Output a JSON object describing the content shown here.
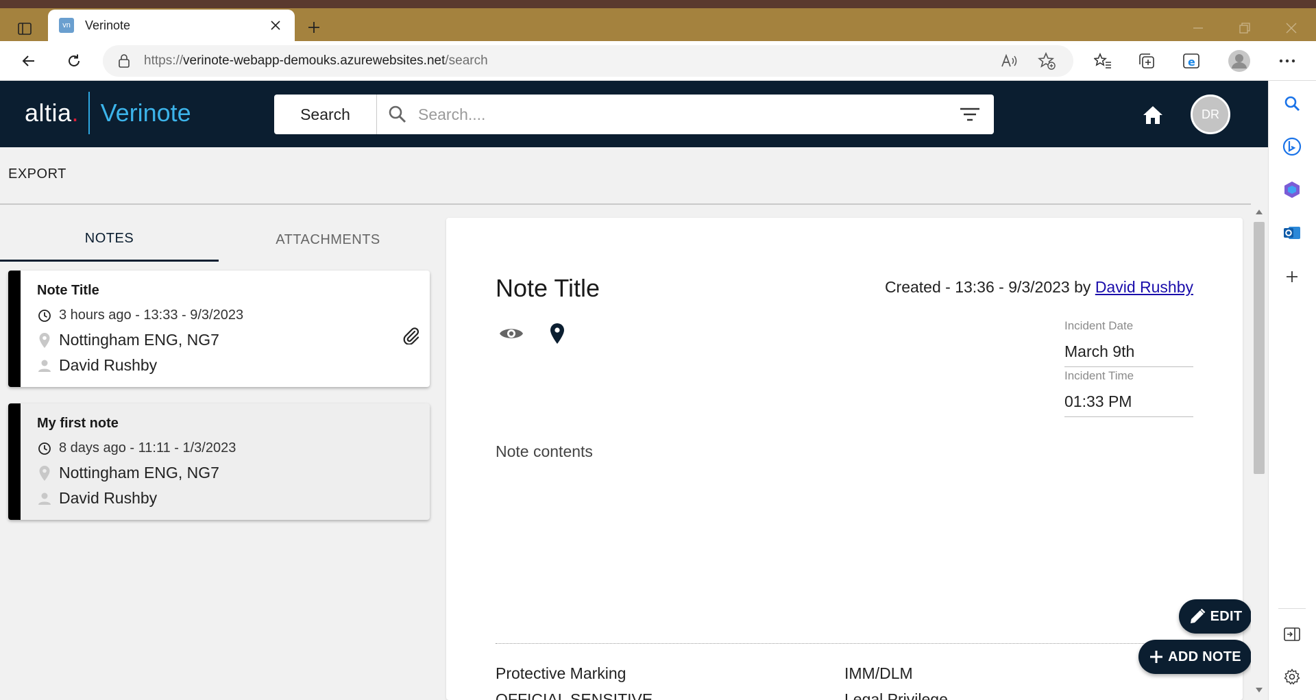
{
  "browser": {
    "tab_title": "Verinote",
    "favicon_text": "vn",
    "url_prefix": "https://",
    "url_host": "verinote-webapp-demouks.azurewebsites.net",
    "url_path": "/search"
  },
  "app": {
    "logo_text": "altia",
    "logo_dot": ".",
    "product_name": "Verinote",
    "search_label": "Search",
    "search_placeholder": "Search....",
    "avatar_initials": "DR"
  },
  "toolbar": {
    "export_label": "EXPORT"
  },
  "tabs": [
    {
      "label": "NOTES",
      "active": true
    },
    {
      "label": "ATTACHMENTS",
      "active": false
    }
  ],
  "notes": [
    {
      "title": "Note Title",
      "time": "3 hours ago - 13:33 - 9/3/2023",
      "location": "Nottingham ENG, NG7",
      "author": "David Rushby",
      "has_attachment": true,
      "selected": true
    },
    {
      "title": "My first note",
      "time": "8 days ago - 11:11 - 1/3/2023",
      "location": "Nottingham ENG, NG7",
      "author": "David Rushby",
      "has_attachment": false,
      "selected": false
    }
  ],
  "detail": {
    "title": "Note Title",
    "created_prefix": "Created - 13:36 - 9/3/2023 by ",
    "created_by": "David Rushby",
    "incident_date_label": "Incident Date",
    "incident_date": "March 9th",
    "incident_time_label": "Incident Time",
    "incident_time": "01:33 PM",
    "contents": "Note contents",
    "protective_marking_label": "Protective Marking",
    "protective_marking_value": "OFFICIAL SENSITIVE",
    "imm_dlm_label": "IMM/DLM",
    "imm_dlm_value": "Legal Privilege"
  },
  "actions": {
    "edit_label": "EDIT",
    "add_note_label": "ADD NOTE"
  },
  "colors": {
    "header_bg": "#0b1e30",
    "brand_cyan": "#3cb4ea",
    "brand_red": "#e01e37",
    "tabbar_bg": "#a4823e"
  }
}
